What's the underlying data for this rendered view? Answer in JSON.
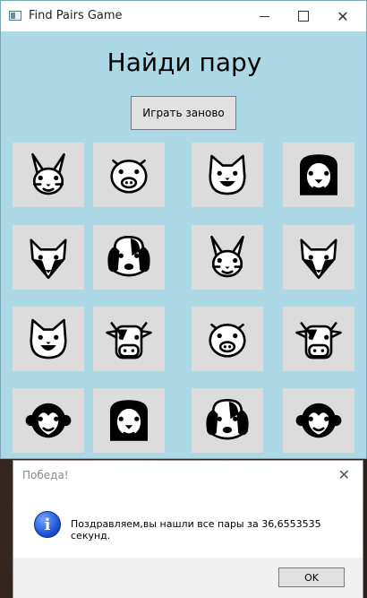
{
  "window": {
    "title": "Find Pairs Game",
    "icon": "app-window-icon",
    "controls": [
      "minimize-icon",
      "maximize-icon",
      "close-icon"
    ]
  },
  "game": {
    "heading": "Найди пару",
    "replay_label": "Играть заново",
    "background_color": "#add8e6",
    "card_color": "#dcdcdc",
    "cards": [
      {
        "animal": "rabbit"
      },
      {
        "animal": "pig"
      },
      {
        "animal": "cat"
      },
      {
        "animal": "lion"
      },
      {
        "animal": "fox"
      },
      {
        "animal": "dog"
      },
      {
        "animal": "rabbit"
      },
      {
        "animal": "fox"
      },
      {
        "animal": "cat"
      },
      {
        "animal": "cow"
      },
      {
        "animal": "pig"
      },
      {
        "animal": "cow"
      },
      {
        "animal": "monkey"
      },
      {
        "animal": "lion"
      },
      {
        "animal": "dog"
      },
      {
        "animal": "monkey"
      }
    ]
  },
  "dialog": {
    "title": "Победа!",
    "message": "Поздравляем,вы нашли все пары за 36,6553535 секунд.",
    "ok_label": "OK",
    "icon": "info-icon"
  }
}
